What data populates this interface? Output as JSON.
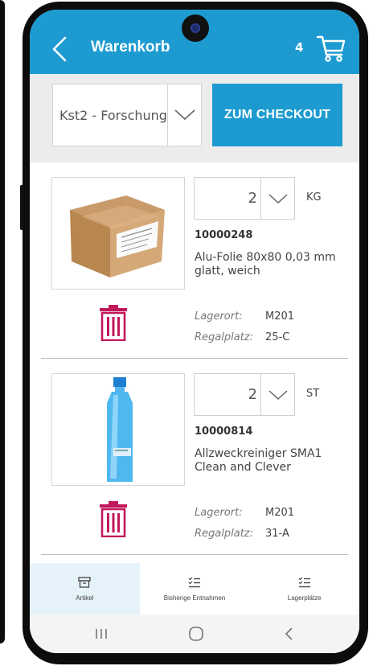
{
  "header": {
    "title": "Warenkorb",
    "cart_count": "4",
    "back_icon": "chevron-left-icon",
    "cart_icon": "shopping-cart-icon"
  },
  "toolbar": {
    "cost_center": "Kst2 - Forschung",
    "checkout_label": "ZUM CHECKOUT"
  },
  "items": [
    {
      "quantity": "2",
      "unit": "KG",
      "article_no": "10000248",
      "description": "Alu-Folie 80x80 0,03 mm glatt, weich",
      "location_label": "Lagerort:",
      "location": "M201",
      "shelf_label": "Regalplatz:",
      "shelf": "25-C"
    },
    {
      "quantity": "2",
      "unit": "ST",
      "article_no": "10000814",
      "description": "Allzweckreiniger SMA1 Clean and Clever",
      "location_label": "Lagerort:",
      "location": "M201",
      "shelf_label": "Regalplatz:",
      "shelf": "31-A"
    }
  ],
  "bottom_nav": [
    {
      "label": "Artikel",
      "icon": "archive-box-icon",
      "active": true
    },
    {
      "label": "Bisherige Entnahmen",
      "icon": "checklist-icon",
      "active": false
    },
    {
      "label": "Lagerplätze",
      "icon": "checklist-icon",
      "active": false
    }
  ],
  "colors": {
    "primary": "#1d9bd1",
    "trash": "#c2185b"
  }
}
